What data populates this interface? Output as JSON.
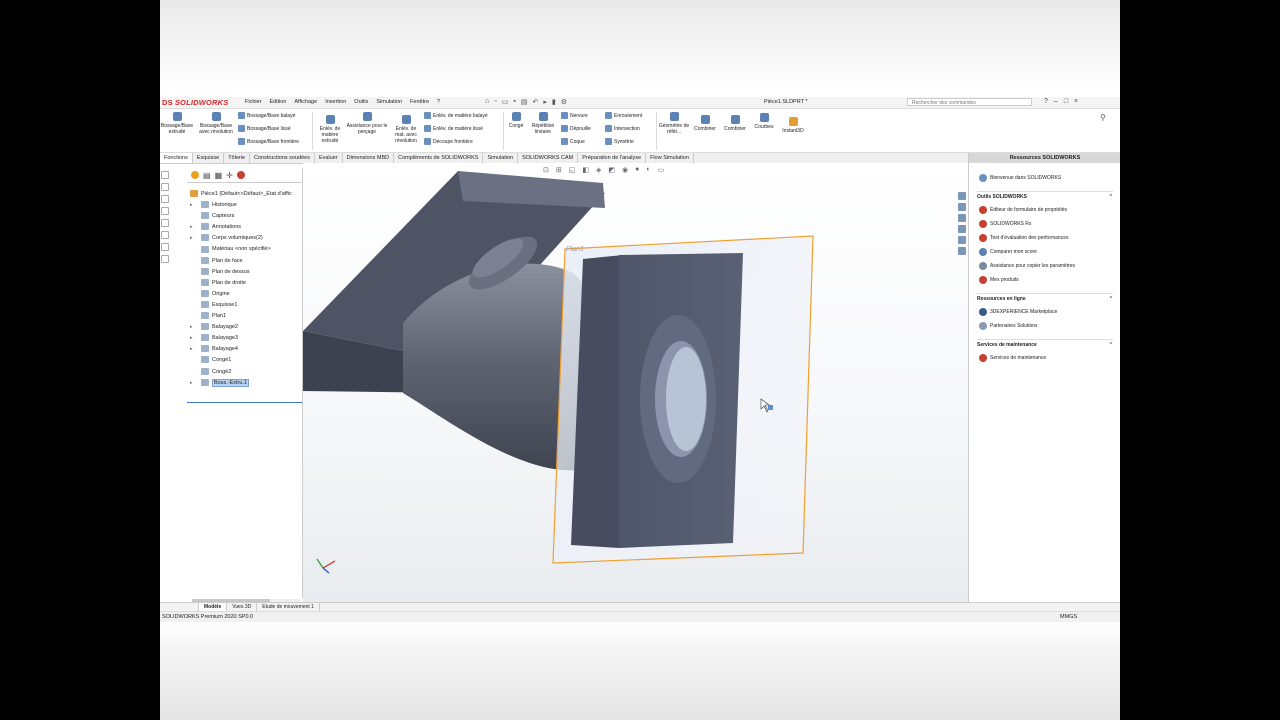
{
  "app": {
    "brand": "SOLIDWORKS",
    "ds": "DS",
    "doc_title": "Pièce1.SLDPRT *"
  },
  "menu": [
    "Fichier",
    "Edition",
    "Affichage",
    "Insertion",
    "Outils",
    "Simulation",
    "Fenêtre",
    "?"
  ],
  "search_placeholder": "Rechercher des commandes",
  "window_buttons": [
    "?",
    "–",
    "□",
    "×"
  ],
  "ribbon": {
    "bossage_extrude": "Bossage/Base extrudé",
    "bossage_revolution": "Bossage/Base avec révolution",
    "bossage_balaye": "Bossage/Base balayé",
    "bossage_lisse": "Bossage/Base lissé",
    "bossage_frontiere": "Bossage/Base frontière",
    "enlev_extrude": "Enlèv. de matière extrudé",
    "assistance_percage": "Assistance pour le perçage",
    "enlev_revolution": "Enlèv. de mat. avec révolution",
    "enlev_balaye": "Enlèv. de matière balayé",
    "enlev_lisse": "Enlèv. de matière lissé",
    "decoupe_frontiere": "Découpe frontière",
    "conge": "Congé",
    "repetition_lineaire": "Répétition linéaire",
    "nervure": "Nervure",
    "depouille": "Dépouille",
    "coque": "Coque",
    "enroulement": "Enroulement",
    "intersection": "Intersection",
    "symetrie": "Symétrie",
    "geometrie_ref": "Géométrie de référ...",
    "combiner1": "Combiner",
    "combiner2": "Combiner",
    "courbes": "Courbes",
    "instant3d": "Instant3D"
  },
  "tabs": [
    "Fonctions",
    "Esquisse",
    "Tôlerie",
    "Constructions soudées",
    "Evaluer",
    "Dimensions MBD",
    "Compléments de SOLIDWORKS",
    "Simulation",
    "SOLIDWORKS CAM",
    "Préparation de l'analyse",
    "Flow Simulation"
  ],
  "tree": {
    "root": "Pièce1 (Défaut<<Défaut>_Etat d'affic",
    "items": [
      {
        "label": "Historique",
        "arrow": "▸"
      },
      {
        "label": "Capteurs",
        "arrow": ""
      },
      {
        "label": "Annotations",
        "arrow": "▸"
      },
      {
        "label": "Corps volumiques(2)",
        "arrow": "▸"
      },
      {
        "label": "Matériau <non spécifié>",
        "arrow": ""
      },
      {
        "label": "Plan de face",
        "arrow": ""
      },
      {
        "label": "Plan de dessus",
        "arrow": ""
      },
      {
        "label": "Plan de droite",
        "arrow": ""
      },
      {
        "label": "Origine",
        "arrow": ""
      },
      {
        "label": "Esquisse1",
        "arrow": ""
      },
      {
        "label": "Plan1",
        "arrow": ""
      },
      {
        "label": "Balayage2",
        "arrow": "▸"
      },
      {
        "label": "Balayage3",
        "arrow": "▸"
      },
      {
        "label": "Balayage4",
        "arrow": "▸"
      },
      {
        "label": "Congé1",
        "arrow": ""
      },
      {
        "label": "Congé2",
        "arrow": ""
      },
      {
        "label": "Boss.-Extru.1",
        "arrow": "▸"
      }
    ]
  },
  "viewport": {
    "plane_label": "Plan1"
  },
  "resources": {
    "header": "Ressources SOLIDWORKS",
    "welcome": "Bienvenue dans SOLIDWORKS",
    "outils_title": "Outils SOLIDWORKS",
    "outils": [
      "Éditeur de formulaire de propriétés",
      "SOLIDWORKS Rx",
      "Test d'évaluation des performances",
      "Comparer mon score",
      "Assistance pour copier les paramètres",
      "Mes produits"
    ],
    "enligne_title": "Ressources en ligne",
    "enligne": [
      "3DEXPERIENCE Marketplace",
      "Partenaires Solutions"
    ],
    "maintenance_title": "Services de maintenance",
    "maintenance": [
      "Services de maintenance"
    ]
  },
  "bottom_tabs": [
    "Modèle",
    "Vues 3D",
    "Etude de mouvement 1"
  ],
  "status": {
    "left": "SOLIDWORKS Premium 2020 SP0.0",
    "units": "MMGS"
  },
  "colors": {
    "accent": "#d42a2a",
    "selection": "#f0a030",
    "part": "#5c6270"
  }
}
